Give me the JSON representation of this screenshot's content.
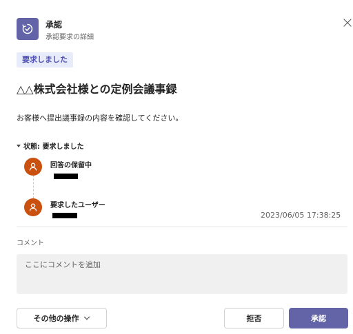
{
  "header": {
    "app_title": "承認",
    "app_subtitle": "承認要求の詳細",
    "app_icon": "approvals-icon",
    "close_icon": "close-icon"
  },
  "status_badge": "要求しました",
  "request": {
    "title": "△△株式会社様との定例会議事録",
    "description": "お客様へ提出議事録の内容を確認してください。"
  },
  "status_section": {
    "label": "状態: 要求しました",
    "steps": [
      {
        "label": "回答の保留中",
        "avatar_icon": "person-icon"
      },
      {
        "label": "要求したユーザー",
        "avatar_icon": "person-icon",
        "timestamp": "2023/06/05 17:38:25"
      }
    ]
  },
  "comment": {
    "label": "コメント",
    "placeholder": "ここにコメントを追加",
    "value": ""
  },
  "actions": {
    "more_label": "その他の操作",
    "reject_label": "拒否",
    "approve_label": "承認"
  },
  "colors": {
    "accent": "#6264a7",
    "badge_bg": "#e8ebfa",
    "badge_text": "#4f52b2",
    "avatar": "#ca5010",
    "comment_bg": "#f0f0f0"
  }
}
